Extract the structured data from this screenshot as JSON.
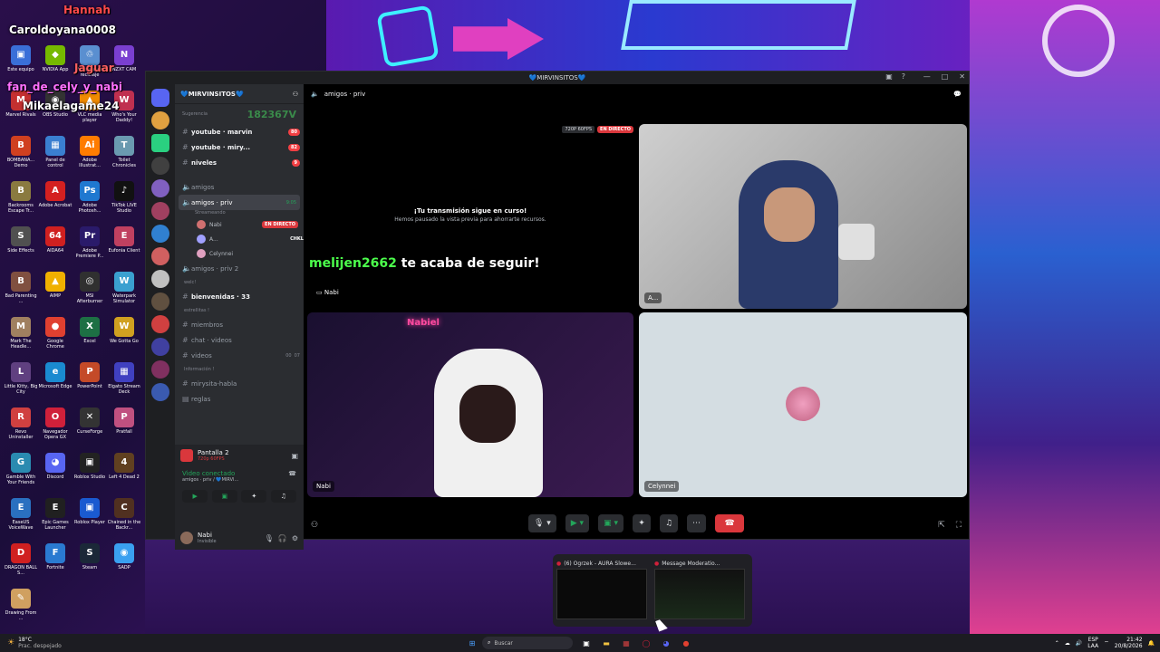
{
  "overlay": {
    "handle": "Hannah",
    "user1": "Caroldoyana0008",
    "user2": "Jaguar",
    "user3": "fan_de_cely_y_nabi",
    "user4": "Mikaelagame24"
  },
  "desktop_icons": [
    {
      "label": "Este equipo",
      "color": "#3a6fd8",
      "glyph": "▣"
    },
    {
      "label": "NVIDIA App",
      "color": "#76b900",
      "glyph": "◆"
    },
    {
      "label": "Papelera de reciclaje",
      "color": "#5a8fd0",
      "glyph": "♲"
    },
    {
      "label": "NZXT CAM",
      "color": "#7a3fd0",
      "glyph": "N"
    },
    {
      "label": "Marvel Rivals",
      "color": "#c43030",
      "glyph": "M"
    },
    {
      "label": "OBS Studio",
      "color": "#333333",
      "glyph": "◉"
    },
    {
      "label": "VLC media player",
      "color": "#f08a00",
      "glyph": "▲"
    },
    {
      "label": "Who's Your Daddy!",
      "color": "#c03050",
      "glyph": "W"
    },
    {
      "label": "BOMBANA... Demo",
      "color": "#d04020",
      "glyph": "B"
    },
    {
      "label": "Panel de control",
      "color": "#3a7fd0",
      "glyph": "▦"
    },
    {
      "label": "Adobe Illustrat...",
      "color": "#ff7c00",
      "glyph": "Ai"
    },
    {
      "label": "Toilet Chronicles",
      "color": "#6a9ab0",
      "glyph": "T"
    },
    {
      "label": "Backrooms Escape Tr...",
      "color": "#8a7a40",
      "glyph": "B"
    },
    {
      "label": "Adobe Acrobat",
      "color": "#d42020",
      "glyph": "A"
    },
    {
      "label": "Adobe Photosh...",
      "color": "#1f78d0",
      "glyph": "Ps"
    },
    {
      "label": "TikTok LIVE Studio",
      "color": "#111111",
      "glyph": "♪"
    },
    {
      "label": "Side Effects",
      "color": "#505050",
      "glyph": "S"
    },
    {
      "label": "AIDA64",
      "color": "#d02020",
      "glyph": "64"
    },
    {
      "label": "Adobe Premiere P...",
      "color": "#2a1a6a",
      "glyph": "Pr"
    },
    {
      "label": "Eufonia Client",
      "color": "#c04060",
      "glyph": "E"
    },
    {
      "label": "Bad Parenting ...",
      "color": "#805040",
      "glyph": "B"
    },
    {
      "label": "AIMP",
      "color": "#f0b000",
      "glyph": "▲"
    },
    {
      "label": "MSI Afterburner",
      "color": "#303030",
      "glyph": "◎"
    },
    {
      "label": "Waterpark Simulator",
      "color": "#3aa0d0",
      "glyph": "W"
    },
    {
      "label": "Mark The Headle...",
      "color": "#a08060",
      "glyph": "M"
    },
    {
      "label": "Google Chrome",
      "color": "#e04030",
      "glyph": "●"
    },
    {
      "label": "Excel",
      "color": "#1d7044",
      "glyph": "X"
    },
    {
      "label": "We Gotta Go",
      "color": "#d0a020",
      "glyph": "W"
    },
    {
      "label": "Little Kitty, Big City",
      "color": "#604080",
      "glyph": "L"
    },
    {
      "label": "Microsoft Edge",
      "color": "#1a8ad0",
      "glyph": "e"
    },
    {
      "label": "PowerPoint",
      "color": "#c44a28",
      "glyph": "P"
    },
    {
      "label": "Elgato Stream Deck",
      "color": "#4040c0",
      "glyph": "▦"
    },
    {
      "label": "Revo Uninstaller",
      "color": "#d04040",
      "glyph": "R"
    },
    {
      "label": "Navegador Opera GX",
      "color": "#d0203a",
      "glyph": "O"
    },
    {
      "label": "CurseForge",
      "color": "#333333",
      "glyph": "✕"
    },
    {
      "label": "Pratfall",
      "color": "#c05080",
      "glyph": "P"
    },
    {
      "label": "Gamble With Your Friends",
      "color": "#2a8ab0",
      "glyph": "G"
    },
    {
      "label": "Discord",
      "color": "#5865f2",
      "glyph": "◕"
    },
    {
      "label": "Roblox Studio",
      "color": "#222222",
      "glyph": "▣"
    },
    {
      "label": "Left 4 Dead 2",
      "color": "#604020",
      "glyph": "4"
    },
    {
      "label": "EaseUS VoiceWave",
      "color": "#2a70c0",
      "glyph": "E"
    },
    {
      "label": "Epic Games Launcher",
      "color": "#202020",
      "glyph": "E"
    },
    {
      "label": "Roblox Player",
      "color": "#1a5ad0",
      "glyph": "▣"
    },
    {
      "label": "Chained in the Backr...",
      "color": "#503020",
      "glyph": "C"
    },
    {
      "label": "DRAGON BALL S...",
      "color": "#d02020",
      "glyph": "D"
    },
    {
      "label": "Fortnite",
      "color": "#2a7ad0",
      "glyph": "F"
    },
    {
      "label": "Steam",
      "color": "#1b2838",
      "glyph": "S"
    },
    {
      "label": "SADP",
      "color": "#3aa0f0",
      "glyph": "◉"
    },
    {
      "label": "Drawing From ...",
      "color": "#d0a060",
      "glyph": "✎"
    }
  ],
  "window": {
    "title": "💙MIRVINSITOS💙",
    "server_name": "💙MIRVINSITOS💙",
    "channel_title": "amigos · priv"
  },
  "sidebar": {
    "suggestion_label": "Sugerencia",
    "counter": "182367V",
    "text_channels": [
      {
        "name": "youtube · marvin",
        "badge": "80",
        "bold": true
      },
      {
        "name": "youtube · miry...",
        "badge": "82",
        "bold": true
      },
      {
        "name": "niveles",
        "badge": "9",
        "bold": true
      }
    ],
    "voice_channels_a": [
      {
        "name": "amigos"
      },
      {
        "name": "amigos · priv",
        "time": "9:05",
        "active": true,
        "sub": "Streameando"
      }
    ],
    "voice_users": [
      {
        "name": "Nabi",
        "live": "EN DIRECTO",
        "color": "#d07070"
      },
      {
        "name": "A...",
        "tag": "CHKL",
        "color": "#a0a0ff"
      },
      {
        "name": "Celynnei",
        "color": "#e0a0c0"
      }
    ],
    "voice_channels_b": [
      {
        "name": "amigos · priv 2"
      }
    ],
    "cat_welc": "welc!",
    "ch_bienvenidas": "bienvenidas · 33",
    "cat_estrellitas": "estrellitas !",
    "ch_miembros": "miembros",
    "ch_chat_videos": "chat · videos",
    "ch_videos": "videos",
    "ch_videos_count": "00",
    "ch_videos_count2": "07",
    "cat_info": "Información !",
    "ch_mirysita": "mirysita-habla",
    "ch_reglas": "reglas"
  },
  "stream_panel": {
    "title": "Pantalla 2",
    "sub": "720p 60FPS"
  },
  "voice_panel": {
    "status": "Video conectado",
    "location": "amigos · priv / 💙MIRVI..."
  },
  "user_panel": {
    "name": "Nabi",
    "status": "Invisible"
  },
  "main": {
    "stream_quality": "720P 60FPS",
    "stream_live": "EN DIRECTO",
    "paused_title": "¡Tu transmisión sigue en curso!",
    "paused_sub": "Hemos pausado la vista previa para ahorrarte recursos.",
    "follow_user": "melijen2662",
    "follow_text": "te acaba de seguir!",
    "stream_owner": "Nabi",
    "tile_top_label": "A...",
    "tile_bl_label": "Nabi",
    "tile_br_label": "Celynnei",
    "neon_sign": "Nabiel"
  },
  "thumbs": [
    {
      "title": "(6) Ogrzek - AURA Slowe..."
    },
    {
      "title": "Message Moderatio..."
    }
  ],
  "taskbar": {
    "weather_temp": "18°C",
    "weather_desc": "Prac. despejado",
    "search_placeholder": "Buscar",
    "lang1": "ESP",
    "lang2": "LAA",
    "time": "21:42",
    "date": "20/8/2026"
  },
  "colors": {
    "discord_bg": "#2b2d31",
    "live_red": "#da373c",
    "green": "#23a55a",
    "follow_green": "#4cff4c"
  }
}
